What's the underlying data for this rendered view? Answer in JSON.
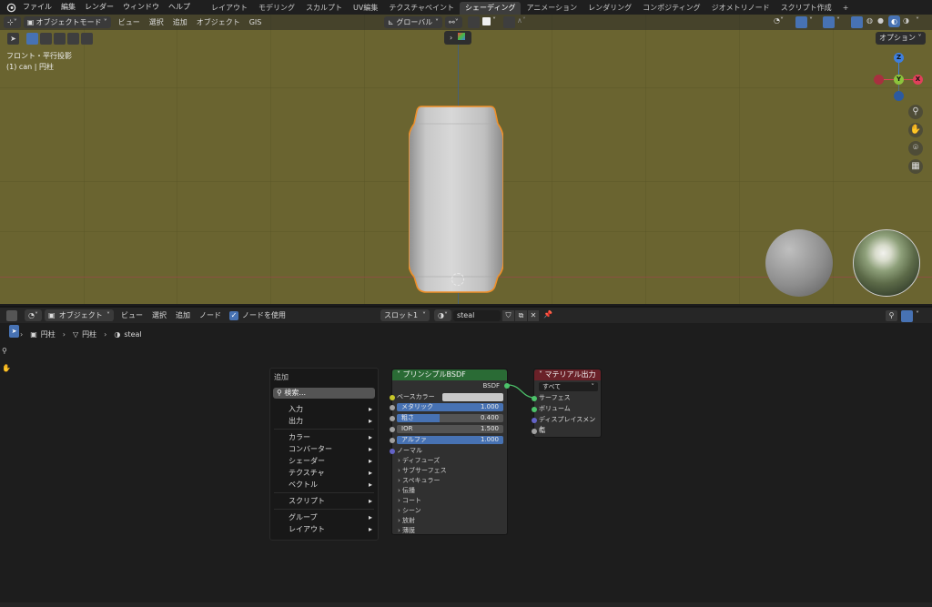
{
  "topbar": {
    "menus": [
      "ファイル",
      "編集",
      "レンダー",
      "ウィンドウ",
      "ヘルプ"
    ],
    "workspaces": [
      "レイアウト",
      "モデリング",
      "スカルプト",
      "UV編集",
      "テクスチャペイント",
      "シェーディング",
      "アニメーション",
      "レンダリング",
      "コンポジティング",
      "ジオメトリノード",
      "スクリプト作成"
    ],
    "active_workspace": "シェーディング",
    "add_tab": "+"
  },
  "viewport": {
    "mode": "オブジェクトモード",
    "menus": [
      "ビュー",
      "選択",
      "追加",
      "オブジェクト",
      "GIS"
    ],
    "transform": "グローバル",
    "options": "オプション",
    "overlay_title": "フロント・平行投影",
    "overlay_object": "(1) can | 円柱",
    "gizmo": {
      "z": "Z",
      "y": "Y",
      "x": "X"
    },
    "colors": {
      "background": "#6a6430",
      "x_axis": "#e0405a",
      "y_axis": "#8cc43c",
      "z_axis": "#3e7fde",
      "select_outline": "#f0902a"
    }
  },
  "node_editor": {
    "editor_type": "オブジェクト",
    "menus": [
      "ビュー",
      "選択",
      "追加",
      "ノード"
    ],
    "use_nodes_label": "ノードを使用",
    "use_nodes": true,
    "slot": "スロット1",
    "material": "steal",
    "breadcrumb": [
      "円柱",
      "円柱",
      "steal"
    ]
  },
  "add_menu": {
    "title": "追加",
    "search_placeholder": "検索...",
    "groups": [
      [
        "入力",
        "出力"
      ],
      [
        "カラー",
        "コンバーター",
        "シェーダー",
        "テクスチャ",
        "ベクトル"
      ],
      [
        "スクリプト"
      ],
      [
        "グループ",
        "レイアウト"
      ]
    ]
  },
  "bsdf_node": {
    "title": "プリンシプルBSDF",
    "output": "BSDF",
    "base_color_label": "ベースカラー",
    "fields": [
      {
        "label": "メタリック",
        "value": "1.000",
        "fill": 1.0
      },
      {
        "label": "粗さ",
        "value": "0.400",
        "fill": 0.4
      },
      {
        "label": "IOR",
        "value": "1.500",
        "fill": 0.0
      },
      {
        "label": "アルファ",
        "value": "1.000",
        "fill": 1.0
      }
    ],
    "normal": "ノーマル",
    "panels": [
      "ディフューズ",
      "サブサーフェス",
      "スペキュラー",
      "伝播",
      "コート",
      "シーン",
      "放射",
      "薄膜"
    ],
    "header_color": "#2a6b35"
  },
  "output_node": {
    "title": "マテリアル出力",
    "target": "すべて",
    "inputs": [
      "サーフェス",
      "ボリューム",
      "ディスプレイスメント",
      "幅"
    ],
    "header_color": "#6a2128"
  }
}
